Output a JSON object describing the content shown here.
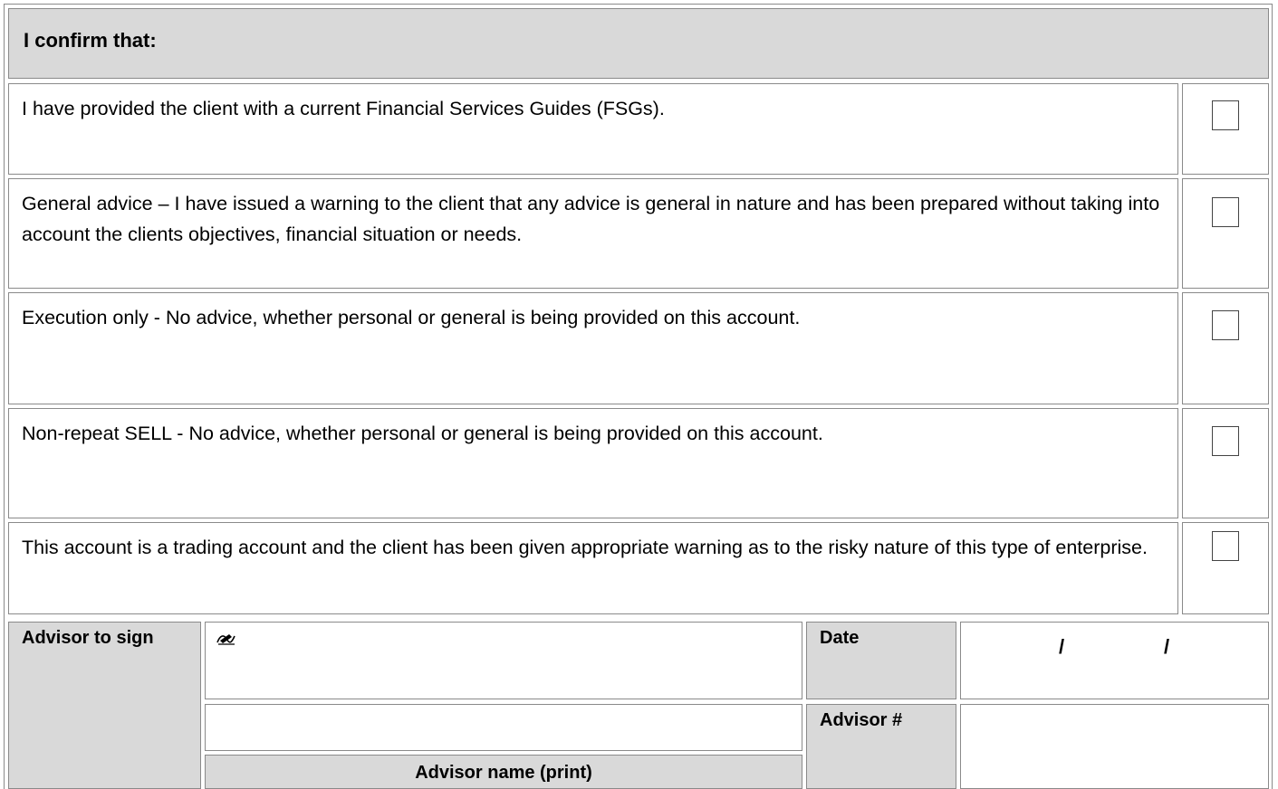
{
  "header": {
    "title": "I confirm that:"
  },
  "statements": [
    {
      "text": "I have provided the client with a current Financial Services Guides (FSGs).",
      "checked": false
    },
    {
      "text": "General advice –  I have issued a warning to the client that any advice is general in nature and has been prepared without taking into account the clients objectives, financial situation or needs.",
      "checked": false
    },
    {
      "text": "Execution only - No advice, whether personal or general is being provided on this account.",
      "checked": false
    },
    {
      "text": "Non-repeat SELL - No advice, whether personal or general is being provided on this account.",
      "checked": false
    },
    {
      "text": "This account is a trading account and the client has been given appropriate warning as to the risky nature of this type of enterprise.",
      "checked": false
    }
  ],
  "signoff": {
    "advisor_sign_label": "Advisor to sign",
    "signature_icon": "pen-signature-icon",
    "date_label": "Date",
    "date_separator": "/",
    "advisor_number_label": "Advisor #",
    "advisor_name_label": "Advisor name (print)"
  }
}
